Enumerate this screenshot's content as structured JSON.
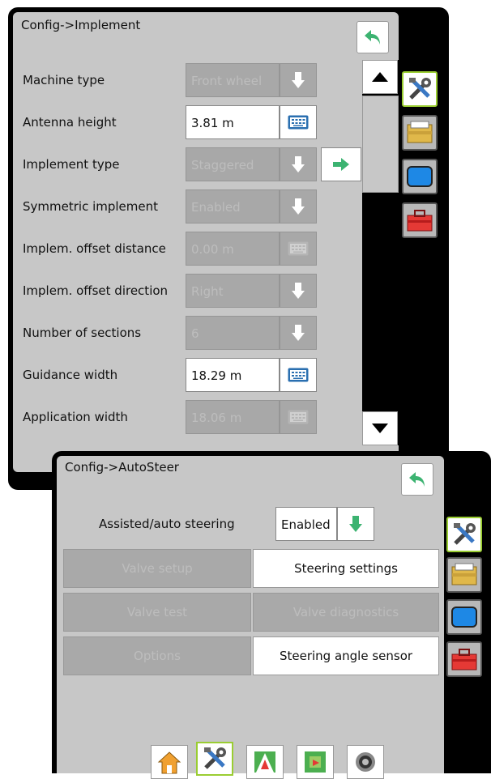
{
  "implement": {
    "title": "Config->Implement",
    "rows": [
      {
        "label": "Machine type",
        "value": "Front wheel",
        "control": "dropdown",
        "enabled": false
      },
      {
        "label": "Antenna height",
        "value": "3.81 m",
        "control": "keyboard",
        "enabled": true
      },
      {
        "label": "Implement type",
        "value": "Staggered",
        "control": "dropdown",
        "enabled": false
      },
      {
        "label": "Symmetric implement",
        "value": "Enabled",
        "control": "dropdown",
        "enabled": false
      },
      {
        "label": "Implem. offset distance",
        "value": "0.00 m",
        "control": "keyboard",
        "enabled": false
      },
      {
        "label": "Implem. offset direction",
        "value": "Right",
        "control": "dropdown",
        "enabled": false
      },
      {
        "label": "Number of sections",
        "value": "6",
        "control": "dropdown",
        "enabled": false
      },
      {
        "label": "Guidance width",
        "value": "18.29 m",
        "control": "keyboard",
        "enabled": true
      },
      {
        "label": "Application width",
        "value": "18.06 m",
        "control": "keyboard",
        "enabled": false
      }
    ]
  },
  "autosteer": {
    "title": "Config->AutoSteer",
    "assisted_label": "Assisted/auto steering",
    "assisted_value": "Enabled",
    "buttons": [
      {
        "label": "Valve setup",
        "enabled": false
      },
      {
        "label": "Steering settings",
        "enabled": true
      },
      {
        "label": "Valve test",
        "enabled": false
      },
      {
        "label": "Valve diagnostics",
        "enabled": false
      },
      {
        "label": "Options",
        "enabled": false
      },
      {
        "label": "Steering angle sensor",
        "enabled": true
      }
    ]
  },
  "tabs": [
    "tools-icon",
    "console-icon",
    "display-icon",
    "toolbox-icon"
  ],
  "nav": [
    "home-icon",
    "tools-icon",
    "guidance-icon",
    "map-icon",
    "camera-icon"
  ],
  "colors": {
    "accent_green": "#9acd32",
    "arrow_green": "#3cb371",
    "panel_bg": "#c7c7c7"
  }
}
